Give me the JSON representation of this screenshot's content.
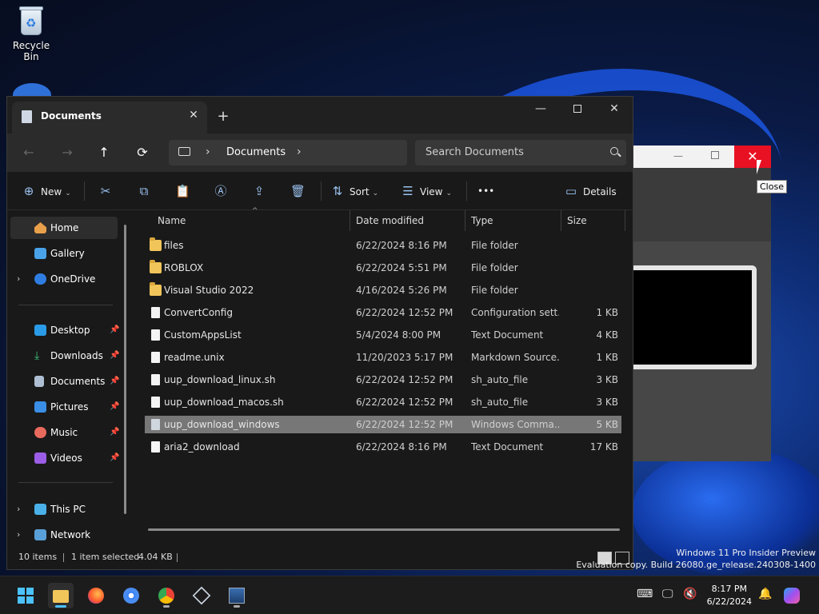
{
  "desktop": {
    "recycle_bin_label": "Recycle Bin",
    "watermark_line1": "Windows 11 Pro Insider Preview",
    "watermark_line2": "Evaluation copy. Build 26080.ge_release.240308-1400",
    "tooltip": "Close"
  },
  "window": {
    "tab_title": "Documents",
    "address_crumb": "Documents",
    "search_placeholder": "Search Documents"
  },
  "toolbar": {
    "new_label": "New",
    "sort_label": "Sort",
    "view_label": "View",
    "more_label": "•••",
    "details_label": "Details"
  },
  "sidebar": {
    "home": "Home",
    "gallery": "Gallery",
    "onedrive": "OneDrive",
    "desktop": "Desktop",
    "downloads": "Downloads",
    "documents": "Documents",
    "pictures": "Pictures",
    "music": "Music",
    "videos": "Videos",
    "thispc": "This PC",
    "network": "Network"
  },
  "columns": {
    "name": "Name",
    "date": "Date modified",
    "type": "Type",
    "size": "Size"
  },
  "files": [
    {
      "name": "files",
      "date": "6/22/2024 8:16 PM",
      "type": "File folder",
      "size": ""
    },
    {
      "name": "ROBLOX",
      "date": "6/22/2024 5:51 PM",
      "type": "File folder",
      "size": ""
    },
    {
      "name": "Visual Studio 2022",
      "date": "4/16/2024 5:26 PM",
      "type": "File folder",
      "size": ""
    },
    {
      "name": "ConvertConfig",
      "date": "6/22/2024 12:52 PM",
      "type": "Configuration sett...",
      "size": "1 KB"
    },
    {
      "name": "CustomAppsList",
      "date": "5/4/2024 8:00 PM",
      "type": "Text Document",
      "size": "4 KB"
    },
    {
      "name": "readme.unix",
      "date": "11/20/2023 5:17 PM",
      "type": "Markdown Source...",
      "size": "1 KB"
    },
    {
      "name": "uup_download_linux.sh",
      "date": "6/22/2024 12:52 PM",
      "type": "sh_auto_file",
      "size": "3 KB"
    },
    {
      "name": "uup_download_macos.sh",
      "date": "6/22/2024 12:52 PM",
      "type": "sh_auto_file",
      "size": "3 KB"
    },
    {
      "name": "uup_download_windows",
      "date": "6/22/2024 12:52 PM",
      "type": "Windows Comma...",
      "size": "5 KB"
    },
    {
      "name": "aria2_download",
      "date": "6/22/2024 8:16 PM",
      "type": "Text Document",
      "size": "17 KB"
    }
  ],
  "status": {
    "items": "10 items",
    "selected": "1 item selected",
    "selsize": "4.04 KB"
  },
  "clock": {
    "time": "8:17 PM",
    "date": "6/22/2024"
  },
  "colors": {
    "accent": "#4cc2ff",
    "close_red": "#e81123",
    "folder": "#f2c55a"
  }
}
